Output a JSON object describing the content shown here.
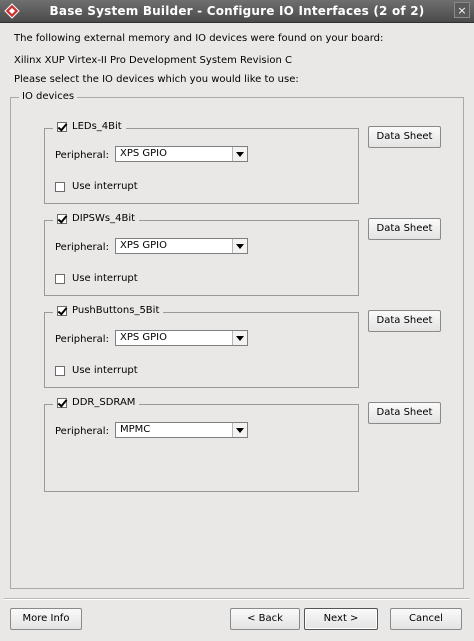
{
  "window": {
    "title": "Base System Builder - Configure IO Interfaces (2 of 2)",
    "close_glyph": "×"
  },
  "intro": {
    "line1": "The following external memory and IO devices were found on your board:",
    "line2": "Xilinx XUP Virtex-II Pro Development System Revision C",
    "line3": "Please select the IO devices which you would like to use:"
  },
  "io_group": {
    "label": "IO devices"
  },
  "devices": [
    {
      "name": "LEDs_4Bit",
      "checked": true,
      "peripheral_label": "Peripheral:",
      "peripheral": "XPS GPIO",
      "interrupt_label": "Use interrupt",
      "interrupt": false,
      "datasheet_label": "Data Sheet"
    },
    {
      "name": "DIPSWs_4Bit",
      "checked": true,
      "peripheral_label": "Peripheral:",
      "peripheral": "XPS GPIO",
      "interrupt_label": "Use interrupt",
      "interrupt": false,
      "datasheet_label": "Data Sheet"
    },
    {
      "name": "PushButtons_5Bit",
      "checked": true,
      "peripheral_label": "Peripheral:",
      "peripheral": "XPS GPIO",
      "interrupt_label": "Use interrupt",
      "interrupt": false,
      "datasheet_label": "Data Sheet"
    },
    {
      "name": "DDR_SDRAM",
      "checked": true,
      "peripheral_label": "Peripheral:",
      "peripheral": "MPMC",
      "datasheet_label": "Data Sheet"
    }
  ],
  "footer": {
    "more_info": "More Info",
    "back": "< Back",
    "next": "Next >",
    "cancel": "Cancel"
  }
}
